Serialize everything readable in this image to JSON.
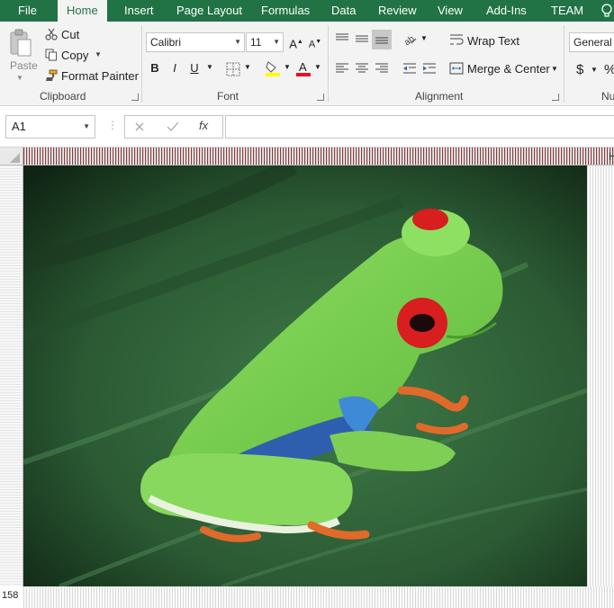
{
  "tabs": [
    "File",
    "Home",
    "Insert",
    "Page Layout",
    "Formulas",
    "Data",
    "Review",
    "View",
    "Add-Ins",
    "TEAM"
  ],
  "active_tab": "Home",
  "clipboard": {
    "paste_label": "Paste",
    "cut_label": "Cut",
    "copy_label": "Copy",
    "format_painter_label": "Format Painter",
    "group_label": "Clipboard"
  },
  "font": {
    "font_name": "Calibri",
    "font_size": "11",
    "bold_label": "B",
    "italic_label": "I",
    "underline_label": "U",
    "group_label": "Font"
  },
  "alignment": {
    "wrap_text_label": "Wrap Text",
    "merge_center_label": "Merge & Center",
    "group_label": "Alignment"
  },
  "number": {
    "format_value": "General",
    "currency_symbol": "$",
    "percent_symbol": "%",
    "group_label_partial": "Nu"
  },
  "formula_bar": {
    "name_box_value": "A1",
    "fx_label": "fx",
    "formula_value": ""
  },
  "sheet": {
    "column_header_partial": "H",
    "row_number": "158"
  },
  "colors": {
    "ribbon_green": "#217346",
    "highlight_yellow": "#ffff00",
    "font_red": "#e81123"
  },
  "image": {
    "subject": "red-eyed tree frog on green leaf"
  }
}
